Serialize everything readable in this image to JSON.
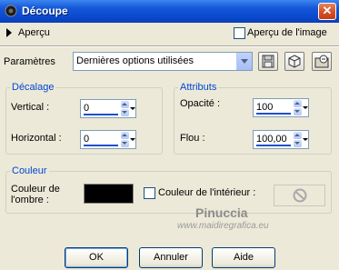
{
  "window": {
    "title": "Découpe",
    "close_glyph": "✕"
  },
  "preview": {
    "label": "Aperçu",
    "checkbox_label": "Aperçu de l'image",
    "checked": false
  },
  "params": {
    "label": "Paramètres",
    "selected": "Dernières options utilisées",
    "tools": [
      "save-preset-icon",
      "reset-cube-icon",
      "preset-manager-icon"
    ]
  },
  "offset_group": {
    "title": "Décalage",
    "vertical_label": "Vertical :",
    "vertical_value": "0",
    "horizontal_label": "Horizontal :",
    "horizontal_value": "0"
  },
  "attributes_group": {
    "title": "Attributs",
    "opacity_label": "Opacité :",
    "opacity_value": "100",
    "blur_label": "Flou :",
    "blur_value": "100,00"
  },
  "color_group": {
    "title": "Couleur",
    "shadow_color_label_1": "Couleur de",
    "shadow_color_label_2": "l'ombre :",
    "shadow_color": "#000000",
    "inner_color_label": "Couleur de l'intérieur :",
    "inner_checked": false
  },
  "watermark": {
    "name": "Pinuccia",
    "url": "www.maidiregrafica.eu"
  },
  "buttons": {
    "ok": "OK",
    "cancel": "Annuler",
    "help": "Aide"
  },
  "colors": {
    "titlebar": "#0a4bd0",
    "group_title": "#0046d5",
    "background": "#ece9d8"
  }
}
